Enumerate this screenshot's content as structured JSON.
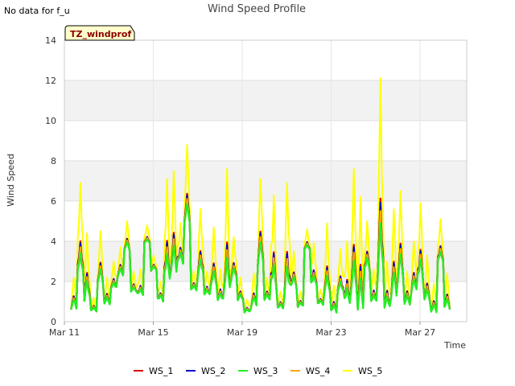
{
  "notice": "No data for f_u",
  "chart_data": {
    "type": "line",
    "title": "Wind Speed Profile",
    "badge": "TZ_windprof",
    "xlabel": "Time",
    "ylabel": "Wind Speed",
    "x_ticks": [
      {
        "day": 11,
        "label": "Mar 11"
      },
      {
        "day": 15,
        "label": "Mar 15"
      },
      {
        "day": 19,
        "label": "Mar 19"
      },
      {
        "day": 23,
        "label": "Mar 23"
      },
      {
        "day": 27,
        "label": "Mar 27"
      }
    ],
    "y_ticks": [
      {
        "value": 0,
        "label": "0"
      },
      {
        "value": 2,
        "label": "2"
      },
      {
        "value": 4,
        "label": "4"
      },
      {
        "value": 6,
        "label": "6"
      },
      {
        "value": 8,
        "label": "8"
      },
      {
        "value": 10,
        "label": "10"
      },
      {
        "value": 12,
        "label": "12"
      },
      {
        "value": 14,
        "label": "14"
      }
    ],
    "xlim": [
      11,
      29.1
    ],
    "ylim": [
      0,
      14
    ],
    "grid": true,
    "legend_position": "bottom",
    "series": [
      {
        "name": "WS_1",
        "color": "#dd0000"
      },
      {
        "name": "WS_2",
        "color": "#0000cc"
      },
      {
        "name": "WS_3",
        "color": "#22ee22"
      },
      {
        "name": "WS_4",
        "color": "#ffa500"
      },
      {
        "name": "WS_5",
        "color": "#ffff00"
      }
    ],
    "x": [
      11.3,
      11.6,
      11.9,
      12.2,
      12.5,
      12.8,
      13.1,
      13.4,
      13.7,
      14.0,
      14.3,
      14.6,
      14.9,
      15.2,
      15.5,
      15.8,
      16.1,
      16.4,
      16.7,
      17.0,
      17.3,
      17.6,
      17.9,
      18.2,
      18.5,
      18.8,
      19.1,
      19.4,
      19.7,
      20.0,
      20.3,
      20.6,
      20.9,
      21.2,
      21.5,
      21.8,
      22.1,
      22.4,
      22.7,
      23.0,
      23.3,
      23.6,
      23.9,
      24.2,
      24.5,
      24.8,
      25.1,
      25.4,
      25.7,
      26.0,
      26.3,
      26.6,
      26.9,
      27.2,
      27.5,
      27.8,
      28.1
    ],
    "ws3": [
      0.6,
      1.9,
      1.0,
      0.5,
      1.8,
      0.8,
      1.5,
      2.2,
      3.5,
      1.4,
      1.2,
      3.8,
      2.5,
      1.0,
      1.8,
      2.2,
      2.8,
      4.6,
      1.5,
      2.0,
      1.2,
      1.6,
      0.9,
      1.3,
      2.0,
      1.0,
      0.4,
      0.7,
      2.6,
      1.0,
      1.4,
      0.6,
      1.0,
      1.7,
      0.7,
      3.5,
      1.6,
      0.8,
      1.2,
      0.4,
      1.3,
      0.7,
      1.1,
      0.4,
      2.4,
      0.8,
      1.8,
      0.5,
      1.1,
      2.0,
      0.8,
      1.3,
      1.9,
      0.9,
      0.4,
      2.8,
      0.6
    ],
    "ws5": [
      2.2,
      6.9,
      4.4,
      1.2,
      4.5,
      2.2,
      3.0,
      3.7,
      5.0,
      2.5,
      2.6,
      4.8,
      3.3,
      2.0,
      7.1,
      7.5,
      4.9,
      8.8,
      2.5,
      5.6,
      2.5,
      4.7,
      2.6,
      7.6,
      4.2,
      2.2,
      1.1,
      2.4,
      7.1,
      2.2,
      6.3,
      1.5,
      6.9,
      3.5,
      1.5,
      4.6,
      3.9,
      1.6,
      4.9,
      1.8,
      3.6,
      4.0,
      7.6,
      6.2,
      5.0,
      2.6,
      12.1,
      3.0,
      5.6,
      6.5,
      2.5,
      4.0,
      5.9,
      3.3,
      1.9,
      5.1,
      2.4
    ]
  },
  "legend": [
    {
      "label": "WS_1"
    },
    {
      "label": "WS_2"
    },
    {
      "label": "WS_3"
    },
    {
      "label": "WS_4"
    },
    {
      "label": "WS_5"
    }
  ]
}
